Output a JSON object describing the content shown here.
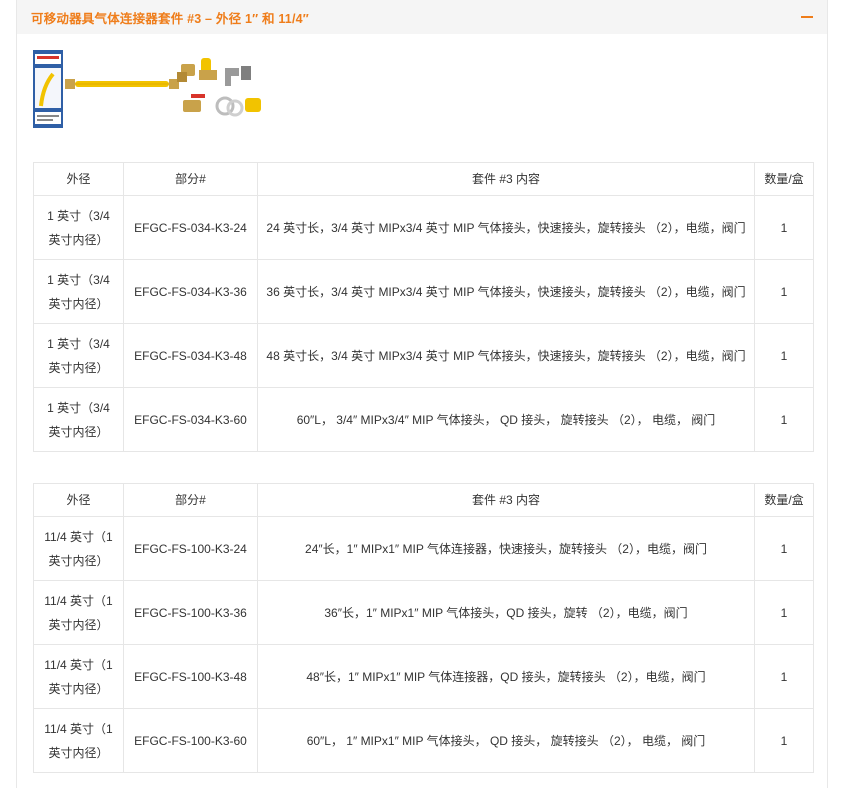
{
  "panel": {
    "title": "可移动器具气体连接器套件 #3 – 外径 1″ 和 11/4″"
  },
  "colors": {
    "accent": "#ef7d1a",
    "header_bg": "#f5f5f5",
    "border": "#e6e6e6",
    "hose_yellow": "#f2c300",
    "brass": "#c9a24a"
  },
  "icons": {
    "collapse": "minus-icon"
  },
  "tables": [
    {
      "headers": [
        "外径",
        "部分#",
        "套件 #3 内容",
        "数量/盒"
      ],
      "rows": [
        [
          "1 英寸（3/4 英寸内径）",
          "EFGC-FS-034-K3-24",
          "24 英寸长，3/4 英寸 MIPx3/4 英寸 MIP 气体接头，快速接头，旋转接头 （2），电缆，阀门",
          "1"
        ],
        [
          "1 英寸（3/4 英寸内径）",
          "EFGC-FS-034-K3-36",
          "36 英寸长，3/4 英寸 MIPx3/4 英寸 MIP 气体接头，快速接头，旋转接头 （2），电缆，阀门",
          "1"
        ],
        [
          "1 英寸（3/4 英寸内径）",
          "EFGC-FS-034-K3-48",
          "48 英寸长，3/4 英寸 MIPx3/4 英寸 MIP 气体接头，快速接头，旋转接头 （2），电缆，阀门",
          "1"
        ],
        [
          "1 英寸（3/4 英寸内径）",
          "EFGC-FS-034-K3-60",
          "60″L， 3/4″ MIPx3/4″ MIP 气体接头， QD 接头， 旋转接头 （2）， 电缆， 阀门",
          "1"
        ]
      ]
    },
    {
      "headers": [
        "外径",
        "部分#",
        "套件 #3 内容",
        "数量/盒"
      ],
      "rows": [
        [
          "11/4 英寸（1 英寸内径）",
          "EFGC-FS-100-K3-24",
          "24″长，1″ MIPx1″ MIP 气体连接器，快速接头，旋转接头 （2），电缆，阀门",
          "1"
        ],
        [
          "11/4 英寸（1 英寸内径）",
          "EFGC-FS-100-K3-36",
          "36″长，1″ MIPx1″ MIP 气体接头，QD 接头，旋转 （2），电缆，阀门",
          "1"
        ],
        [
          "11/4 英寸（1 英寸内径）",
          "EFGC-FS-100-K3-48",
          "48″长，1″ MIPx1″ MIP 气体连接器，QD 接头，旋转接头 （2），电缆，阀门",
          "1"
        ],
        [
          "11/4 英寸（1 英寸内径）",
          "EFGC-FS-100-K3-60",
          "60″L， 1″ MIPx1″ MIP 气体接头， QD 接头， 旋转接头 （2）， 电缆， 阀门",
          "1"
        ]
      ]
    }
  ]
}
